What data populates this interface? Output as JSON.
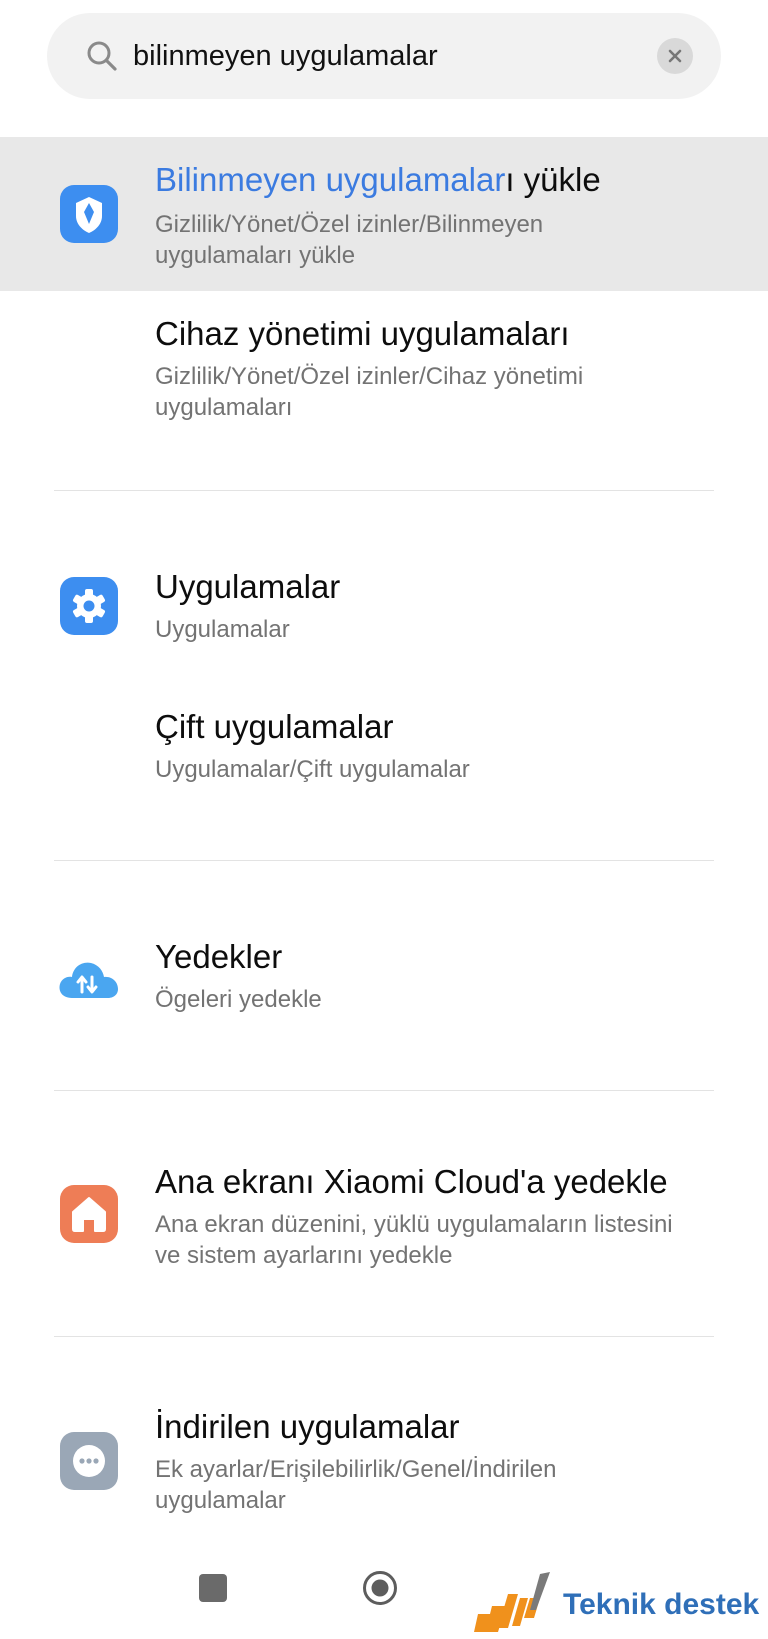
{
  "search": {
    "value": "bilinmeyen uygulamalar",
    "icon": "search-icon",
    "clear_icon": "close-icon"
  },
  "results": [
    {
      "title_match": "Bilinmeyen uygulamalar",
      "title_rest": "ı yükle",
      "subtitle": "Gizlilik/Yönet/Özel izinler/Bilinmeyen uygulamaları yükle",
      "icon": "shield-icon",
      "icon_color": "#3d8ef0"
    },
    {
      "title": "Cihaz yönetimi uygulamaları",
      "subtitle": "Gizlilik/Yönet/Özel izinler/Cihaz yönetimi uygulamaları"
    },
    {
      "title": "Uygulamalar",
      "subtitle": "Uygulamalar",
      "icon": "gear-icon",
      "icon_color": "#3d8ef0"
    },
    {
      "title": "Çift uygulamalar",
      "subtitle": "Uygulamalar/Çift uygulamalar"
    },
    {
      "title": "Yedekler",
      "subtitle": "Ögeleri yedekle",
      "icon": "cloud-sync-icon",
      "icon_color": "#4aa6f0"
    },
    {
      "title": "Ana ekranı Xiaomi Cloud'a yedekle",
      "subtitle": "Ana ekran düzenini, yüklü uygulamaların listesini ve sistem ayarlarını yedekle",
      "icon": "home-icon",
      "icon_color": "#ee7d56"
    },
    {
      "title": "İndirilen uygulamalar",
      "subtitle": "Ek ayarlar/Erişilebilirlik/Genel/İndirilen uygulamalar",
      "icon": "more-dots-icon",
      "icon_color": "#9aa7b6"
    }
  ],
  "navbar": {
    "recents_icon": "square-icon",
    "home_icon": "circle-icon"
  },
  "watermark": {
    "logo": "dji-logo",
    "text": "Teknik destek",
    "color": "#2f6fb8",
    "logo_color": "#f0911c"
  }
}
